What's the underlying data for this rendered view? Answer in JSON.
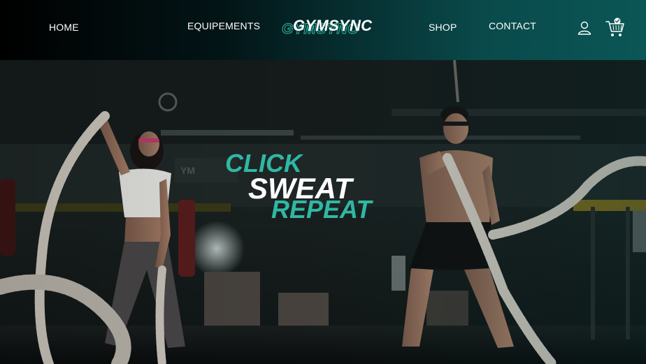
{
  "nav": {
    "home": "HOME",
    "equipements": "EQUIPEMENTS",
    "logo": "GYMSYNC",
    "shop": "SHOP",
    "contact": "CONTACT",
    "icons": [
      "user-icon",
      "cart-icon"
    ]
  },
  "hero": {
    "line1": "CLICK",
    "line2": "SWEAT",
    "line3": "REPEAT"
  },
  "colors": {
    "accent": "#2fb8a4",
    "nav_start": "#000000",
    "nav_end": "#0b5656",
    "text": "#ffffff"
  }
}
